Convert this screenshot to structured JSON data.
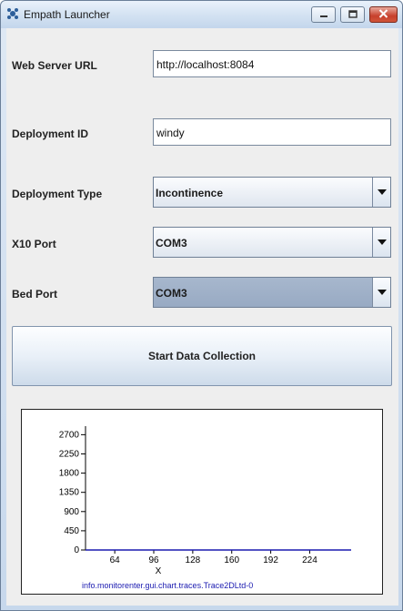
{
  "window": {
    "title": "Empath Launcher",
    "icons": [
      "app-icon",
      "minimize-icon",
      "maximize-icon",
      "close-icon"
    ]
  },
  "form": {
    "web_server_url": {
      "label": "Web Server URL",
      "value": "http://localhost:8084"
    },
    "deployment_id": {
      "label": "Deployment ID",
      "value": "windy"
    },
    "deployment_type": {
      "label": "Deployment Type",
      "value": "Incontinence"
    },
    "x10_port": {
      "label": "X10 Port",
      "value": "COM3"
    },
    "bed_port": {
      "label": "Bed Port",
      "value": "COM3"
    }
  },
  "actions": {
    "start_label": "Start Data Collection"
  },
  "chart_data": {
    "type": "line",
    "title": "",
    "xlabel": "X",
    "ylabel": "",
    "x_ticks": [
      64,
      96,
      128,
      160,
      192,
      224
    ],
    "y_ticks": [
      0,
      450,
      900,
      1350,
      1800,
      2250,
      2700
    ],
    "xlim": [
      40,
      258
    ],
    "ylim": [
      0,
      2900
    ],
    "legend_position": "bottom",
    "series": [
      {
        "name": "info.monitorenter.gui.chart.traces.Trace2DLtd-0",
        "color": "#1a1ab0",
        "x": [
          40,
          258
        ],
        "y": [
          0,
          0
        ]
      }
    ]
  }
}
